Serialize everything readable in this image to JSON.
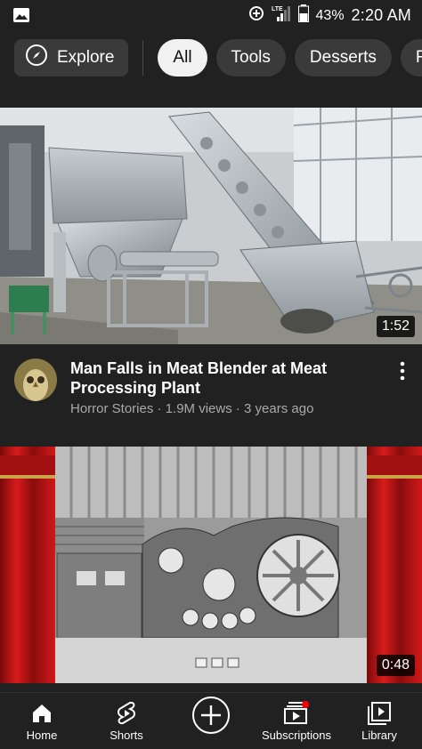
{
  "status_bar": {
    "network": "LTE",
    "battery": "43%",
    "time": "2:20 AM"
  },
  "chips": {
    "explore_label": "Explore",
    "items": [
      "All",
      "Tools",
      "Desserts",
      "Re"
    ],
    "active": "All"
  },
  "videos": [
    {
      "title": "Man Falls in Meat Blender at Meat Processing Plant",
      "channel": "Horror Stories",
      "views": "1.9M views",
      "age": "3 years ago",
      "subtitle": "Horror Stories · 1.9M views · 3 years ago",
      "duration": "1:52"
    },
    {
      "duration": "0:48"
    }
  ],
  "bottom_nav": {
    "home": "Home",
    "shorts": "Shorts",
    "subscriptions": "Subscriptions",
    "library": "Library"
  },
  "colors": {
    "background": "#212121",
    "chip": "#3a3a3a",
    "chip_active": "#f1f1f1",
    "subtitle_text": "#aaaaaa",
    "notification_dot": "#ff0000"
  }
}
